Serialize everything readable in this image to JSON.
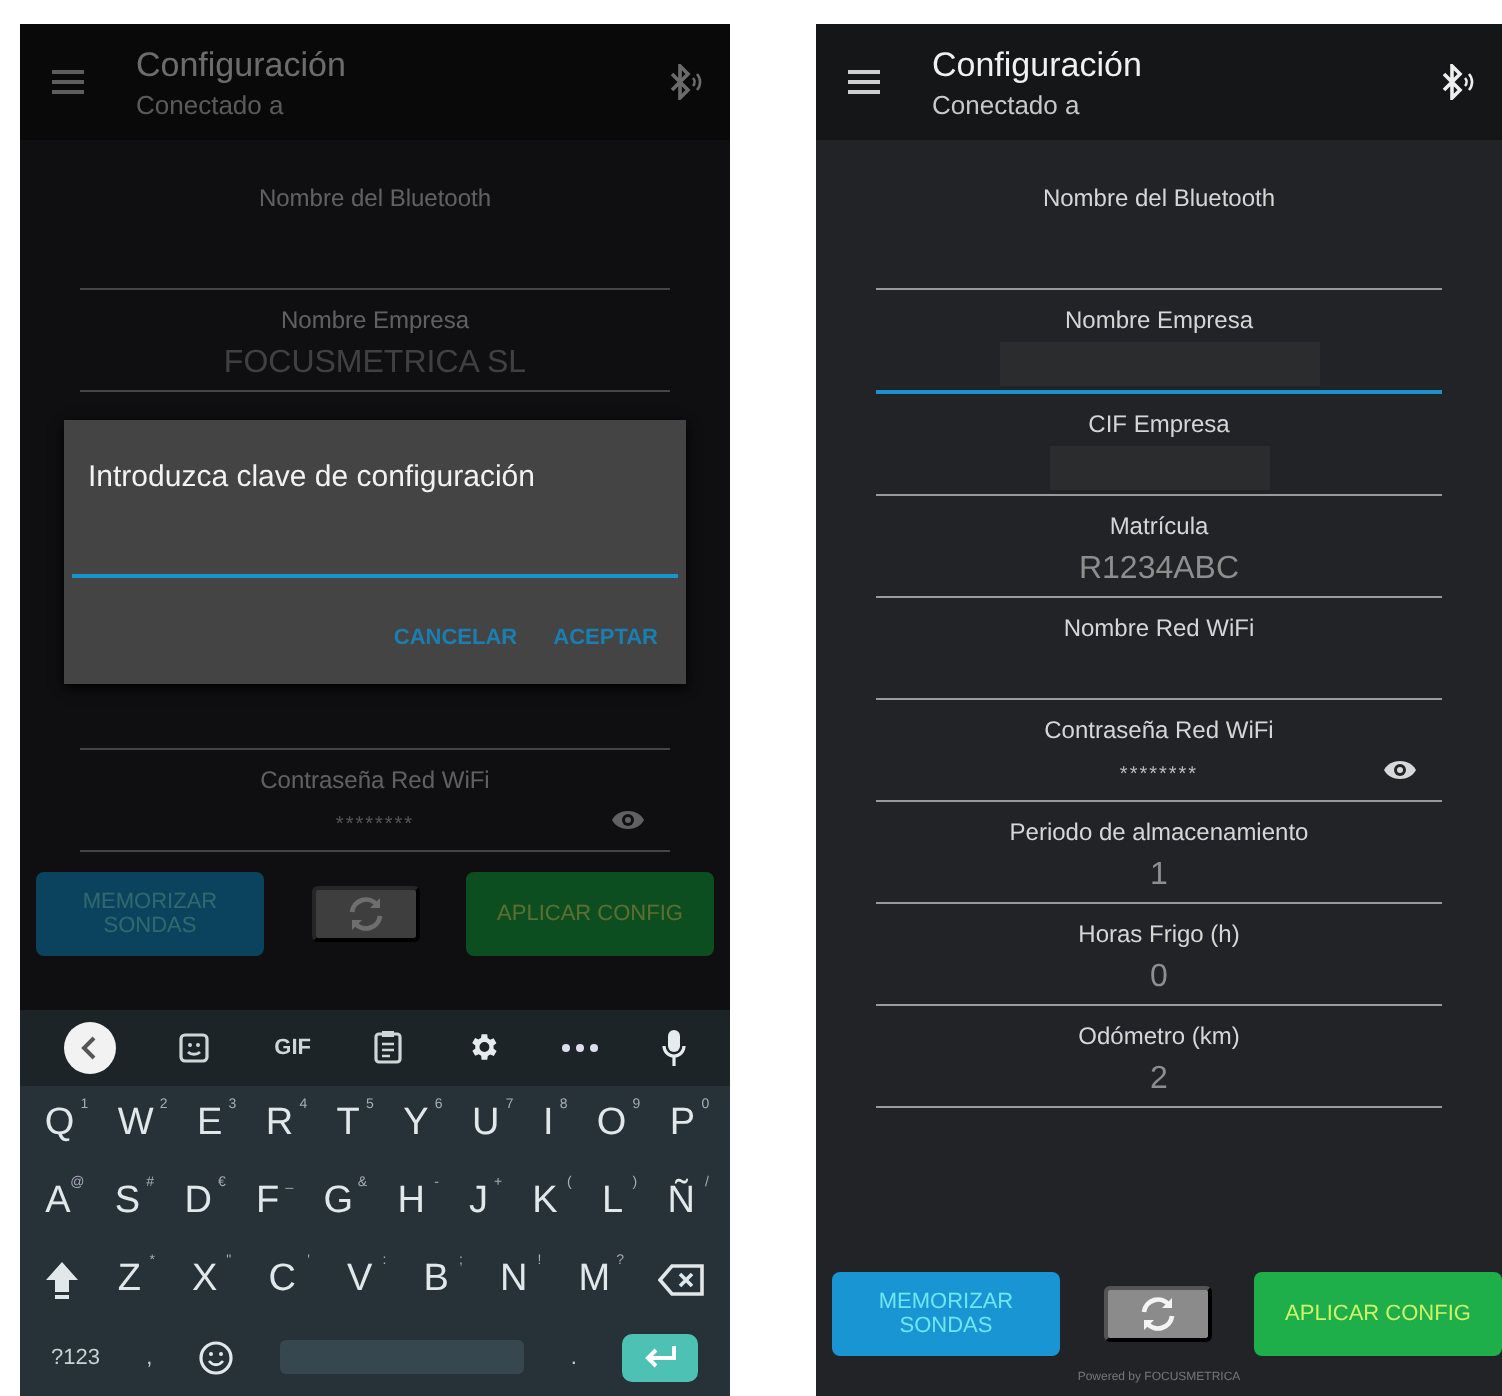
{
  "screens": [
    {
      "title": "Configuración",
      "subtitle": "Conectado a",
      "fields": [
        {
          "label": "Nombre del Bluetooth",
          "kind": "text",
          "focused": false
        },
        {
          "label": "Nombre Empresa",
          "kind": "text",
          "value": "FOCUSMETRICA SL",
          "focused": false
        }
      ],
      "dialog": {
        "title": "Introduzca clave de configuración",
        "focused": true,
        "actions": [
          "CANCELAR",
          "ACEPTAR"
        ]
      },
      "fields_below": [
        {
          "label": "Contraseña Red WiFi",
          "kind": "password",
          "value": "********",
          "focused": false
        }
      ],
      "buttons": [
        {
          "kind": "blue",
          "label": "MEMORIZAR SONDAS"
        },
        {
          "kind": "refresh"
        },
        {
          "kind": "green",
          "label": "APLICAR CONFIG"
        }
      ],
      "keyboard": {
        "toolbar": [
          {
            "kind": "back"
          },
          {
            "kind": "sticker"
          },
          {
            "kind": "text",
            "label": "GIF"
          },
          {
            "kind": "clipboard"
          },
          {
            "kind": "settings"
          },
          {
            "kind": "more"
          },
          {
            "kind": "mic"
          }
        ],
        "rows": [
          [
            {
              "kind": "letter",
              "key": "Q",
              "hint": "1"
            },
            {
              "kind": "letter",
              "key": "W",
              "hint": "2"
            },
            {
              "kind": "letter",
              "key": "E",
              "hint": "3"
            },
            {
              "kind": "letter",
              "key": "R",
              "hint": "4"
            },
            {
              "kind": "letter",
              "key": "T",
              "hint": "5"
            },
            {
              "kind": "letter",
              "key": "Y",
              "hint": "6"
            },
            {
              "kind": "letter",
              "key": "U",
              "hint": "7"
            },
            {
              "kind": "letter",
              "key": "I",
              "hint": "8"
            },
            {
              "kind": "letter",
              "key": "O",
              "hint": "9"
            },
            {
              "kind": "letter",
              "key": "P",
              "hint": "0"
            }
          ],
          [
            {
              "kind": "letter",
              "key": "A",
              "hint": "@"
            },
            {
              "kind": "letter",
              "key": "S",
              "hint": "#"
            },
            {
              "kind": "letter",
              "key": "D",
              "hint": "€"
            },
            {
              "kind": "letter",
              "key": "F",
              "hint": "_"
            },
            {
              "kind": "letter",
              "key": "G",
              "hint": "&"
            },
            {
              "kind": "letter",
              "key": "H",
              "hint": "-"
            },
            {
              "kind": "letter",
              "key": "J",
              "hint": "+"
            },
            {
              "kind": "letter",
              "key": "K",
              "hint": "("
            },
            {
              "kind": "letter",
              "key": "L",
              "hint": ")"
            },
            {
              "kind": "letter",
              "key": "Ñ",
              "hint": "/"
            }
          ],
          [
            {
              "kind": "shift"
            },
            {
              "kind": "letter",
              "key": "Z",
              "hint": "*"
            },
            {
              "kind": "letter",
              "key": "X",
              "hint": "\""
            },
            {
              "kind": "letter",
              "key": "C",
              "hint": "'"
            },
            {
              "kind": "letter",
              "key": "V",
              "hint": ":"
            },
            {
              "kind": "letter",
              "key": "B",
              "hint": ";"
            },
            {
              "kind": "letter",
              "key": "N",
              "hint": "!"
            },
            {
              "kind": "letter",
              "key": "M",
              "hint": "?"
            },
            {
              "kind": "backspace"
            }
          ],
          [
            {
              "kind": "text",
              "key": "?123"
            },
            {
              "kind": "text",
              "key": ","
            },
            {
              "kind": "emoji"
            },
            {
              "kind": "space"
            },
            {
              "kind": "text",
              "key": "."
            },
            {
              "kind": "enter"
            }
          ]
        ]
      }
    },
    {
      "title": "Configuración",
      "subtitle": "Conectado a",
      "fields": [
        {
          "label": "Nombre del Bluetooth",
          "kind": "text",
          "focused": false
        },
        {
          "label": "Nombre Empresa",
          "kind": "redacted",
          "focused": true
        },
        {
          "label": "CIF Empresa",
          "kind": "redacted",
          "focused": false
        },
        {
          "label": "Matrícula",
          "kind": "text",
          "value": "R1234ABC",
          "focused": false
        },
        {
          "label": "Nombre Red WiFi",
          "kind": "text",
          "focused": false
        },
        {
          "label": "Contraseña Red WiFi",
          "kind": "password",
          "value": "********",
          "focused": false
        },
        {
          "label": "Periodo de almacenamiento",
          "kind": "text",
          "value": "1",
          "focused": false
        },
        {
          "label": "Horas Frigo (h)",
          "kind": "text",
          "value": "0",
          "focused": false
        },
        {
          "label": "Odómetro (km)",
          "kind": "text",
          "value": "2",
          "focused": false
        }
      ],
      "buttons": [
        {
          "kind": "blue",
          "label": "MEMORIZAR SONDAS"
        },
        {
          "kind": "refresh"
        },
        {
          "kind": "green",
          "label": "APLICAR CONFIG"
        }
      ],
      "footer": "Powered by FOCUSMETRICA"
    }
  ]
}
